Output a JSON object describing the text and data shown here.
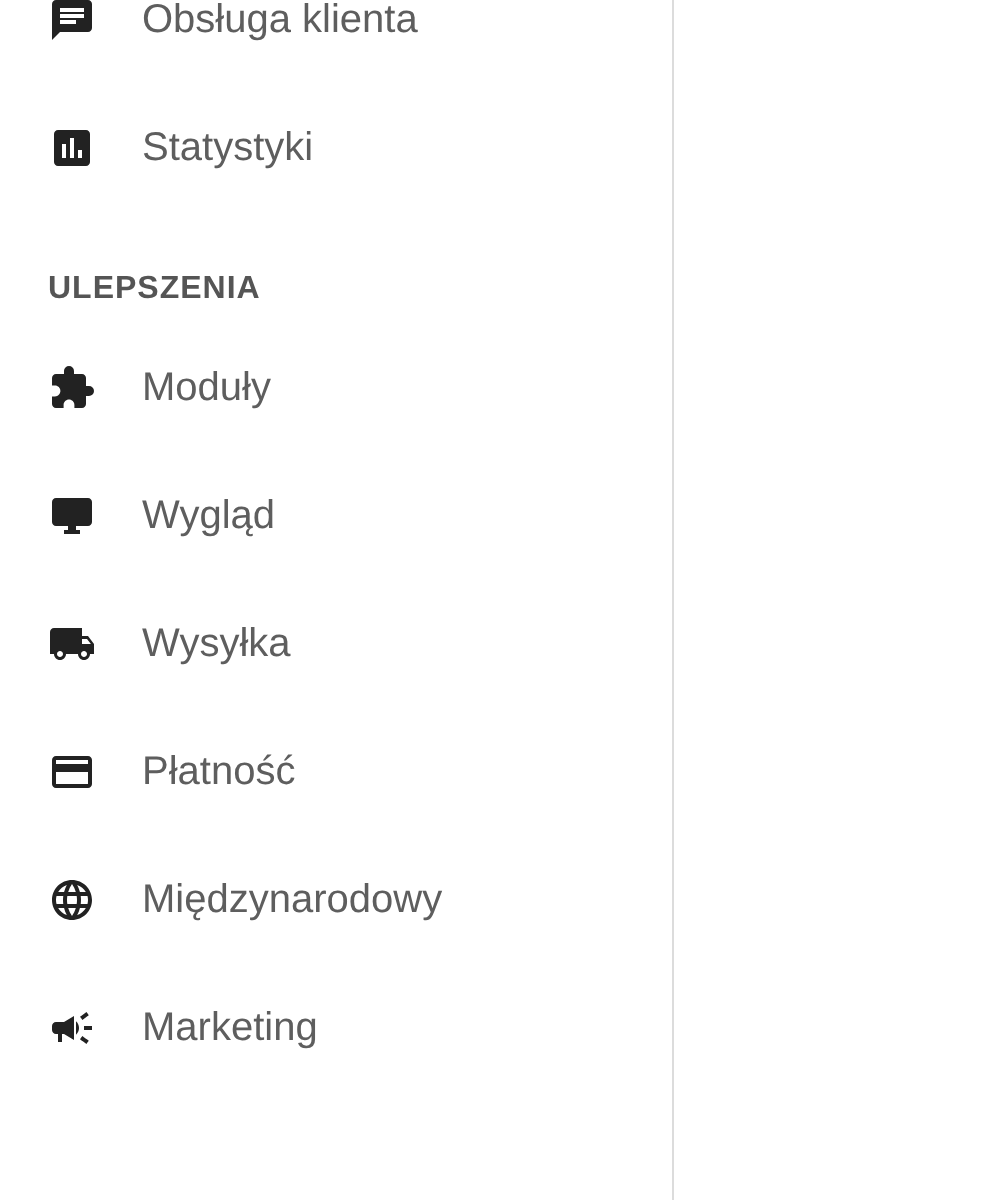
{
  "sidebar": {
    "groups": [
      {
        "items": [
          {
            "label": "Obsługa klienta"
          },
          {
            "label": "Statystyki"
          }
        ]
      },
      {
        "title": "ULEPSZENIA",
        "items": [
          {
            "label": "Moduły"
          },
          {
            "label": "Wygląd"
          },
          {
            "label": "Wysyłka"
          },
          {
            "label": "Płatność"
          },
          {
            "label": "Międzynarodowy"
          },
          {
            "label": "Marketing"
          }
        ]
      }
    ]
  }
}
